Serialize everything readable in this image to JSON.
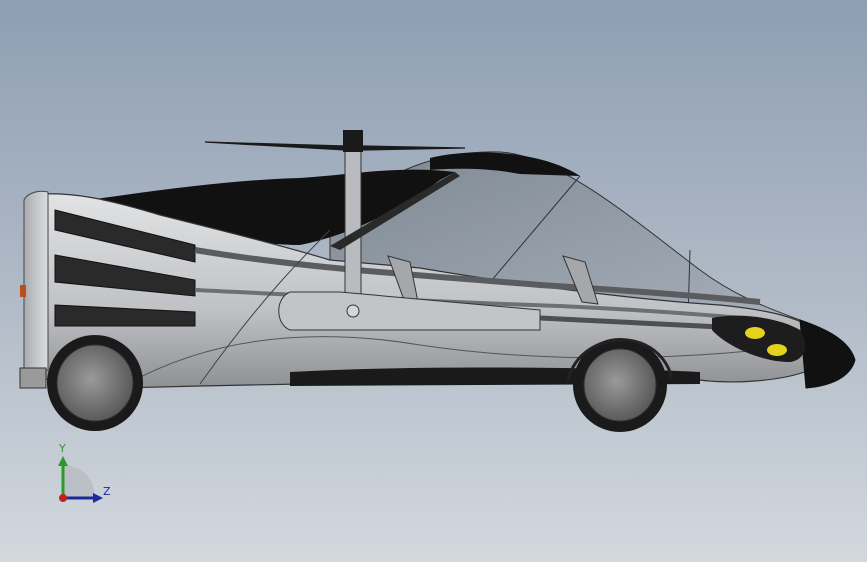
{
  "viewport": {
    "background_top": "#8e9eb3",
    "background_bottom": "#d3d8de"
  },
  "model": {
    "body_color": "#c9cacc",
    "trim_color": "#222222",
    "glass_color": "#8d97a3",
    "headlight_color": "#e4d21c"
  },
  "triad": {
    "y_label": "Y",
    "z_label": "Z",
    "y_color": "#2a9a2a",
    "z_color": "#1a2a9a",
    "x_color": "#c0201a"
  }
}
